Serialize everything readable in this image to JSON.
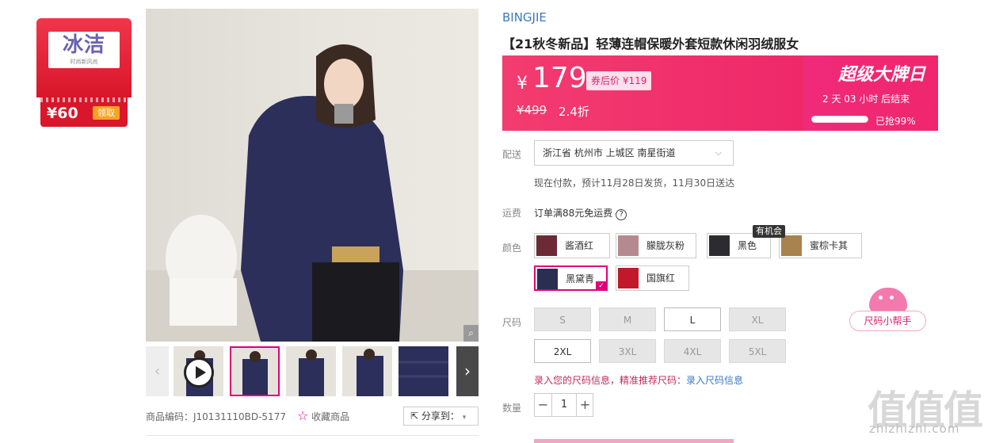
{
  "coupon": {
    "brand": "冰洁",
    "tagline": "时尚新风尚",
    "amount": "¥60",
    "claim_label": "领取"
  },
  "gallery": {
    "zoom_icon": "magnifier-icon",
    "prev_icon": "chevron-left-icon",
    "next_icon": "chevron-right-icon",
    "play_icon": "play-icon",
    "thumb_count": 5,
    "active_thumb": 1
  },
  "meta": {
    "sku_code": "商品编码：J10131110BD-5177",
    "favorite": "收藏商品",
    "share": "分享到："
  },
  "product": {
    "brand": "BINGJIE",
    "title": "【21秋冬新品】轻薄连帽保暖外套短款休闲羽绒服女"
  },
  "price": {
    "currency": "¥",
    "current": "179",
    "coupon_after": "券后价 ¥119",
    "original": "¥499",
    "discount": "2.4折"
  },
  "promo": {
    "title": "超级大牌日",
    "countdown": "2  天  03  小时  后结束",
    "sold_label": "已抢99%",
    "sold_fraction": 0.99
  },
  "shipping": {
    "label": "配送",
    "location": "浙江省 杭州市 上城区 南星街道",
    "note": "现在付款，预计11月28日发货，11月30日送达",
    "fee_label": "运费",
    "fee_text": "订单满88元免运费"
  },
  "colors": {
    "label": "颜色",
    "tooltip": "有机会",
    "options": [
      {
        "name": "酱酒红",
        "swatch": "#6b2a35",
        "selected": false
      },
      {
        "name": "朦胧灰粉",
        "swatch": "#b58a8e",
        "selected": false
      },
      {
        "name": "黑色",
        "swatch": "#2c2b30",
        "selected": false
      },
      {
        "name": "蜜棕卡其",
        "swatch": "#a8824f",
        "selected": false
      },
      {
        "name": "黑黛青",
        "swatch": "#2a2e52",
        "selected": true
      },
      {
        "name": "国旗红",
        "swatch": "#c2182b",
        "selected": false
      }
    ]
  },
  "sizes": {
    "label": "尺码",
    "helper": "尺码小帮手",
    "options": [
      {
        "name": "S",
        "available": false
      },
      {
        "name": "M",
        "available": false
      },
      {
        "name": "L",
        "available": true
      },
      {
        "name": "XL",
        "available": false
      },
      {
        "name": "2XL",
        "available": true
      },
      {
        "name": "3XL",
        "available": false
      },
      {
        "name": "4XL",
        "available": false
      },
      {
        "name": "5XL",
        "available": false
      }
    ],
    "recommend_text": "录入您的尺码信息，精准推荐尺码：",
    "recommend_link": "录入尺码信息"
  },
  "quantity": {
    "label": "数量",
    "value": "1",
    "minus": "−",
    "plus": "+"
  },
  "watermark": {
    "main": "值值值",
    "sub": "zhizhizhi.com"
  },
  "colors_theme": {
    "accent": "#e0007a",
    "price_bg": "#ed1f68",
    "link": "#3a78c3"
  }
}
